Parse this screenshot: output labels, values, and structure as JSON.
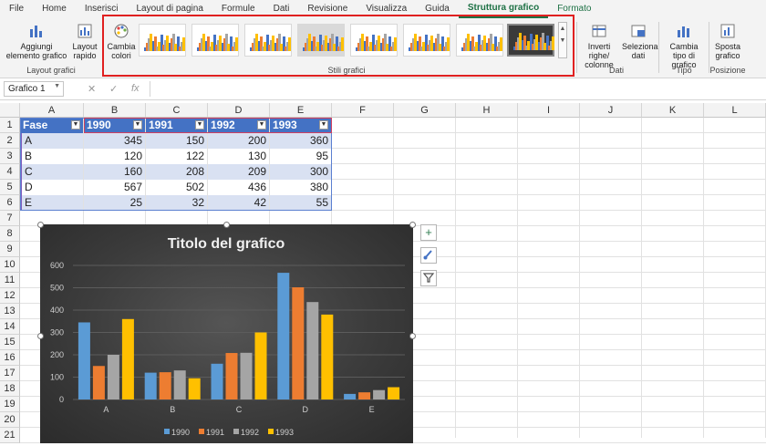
{
  "menu": {
    "tabs": [
      "File",
      "Home",
      "Inserisci",
      "Layout di pagina",
      "Formule",
      "Dati",
      "Revisione",
      "Visualizza",
      "Guida",
      "Struttura grafico",
      "Formato"
    ],
    "active": "Struttura grafico"
  },
  "ribbon": {
    "add_element": "Aggiungi elemento grafico",
    "quick_layout": "Layout rapido",
    "group_layout": "Layout grafici",
    "change_colors": "Cambia colori",
    "group_styles": "Stili grafici",
    "switch_row_col": "Inverti righe/ colonne",
    "select_data": "Seleziona dati",
    "group_data": "Dati",
    "change_type": "Cambia tipo di grafico",
    "group_type": "Tipo",
    "move_chart": "Sposta grafico",
    "group_position": "Posizione"
  },
  "formula_bar": {
    "name_box": "Grafico 1",
    "fx": "fx"
  },
  "sheet": {
    "columns": [
      "A",
      "B",
      "C",
      "D",
      "E",
      "F",
      "G",
      "H",
      "I",
      "J",
      "K",
      "L"
    ],
    "rows": [
      "1",
      "2",
      "3",
      "4",
      "5",
      "6",
      "7",
      "8",
      "9",
      "10",
      "11",
      "12",
      "13",
      "14",
      "15",
      "16",
      "17",
      "18",
      "19",
      "20",
      "21"
    ],
    "table": {
      "headers": [
        "Fase",
        "1990",
        "1991",
        "1992",
        "1993"
      ],
      "rows": [
        [
          "A",
          "345",
          "150",
          "200",
          "360"
        ],
        [
          "B",
          "120",
          "122",
          "130",
          "95"
        ],
        [
          "C",
          "160",
          "208",
          "209",
          "300"
        ],
        [
          "D",
          "567",
          "502",
          "436",
          "380"
        ],
        [
          "E",
          "25",
          "32",
          "42",
          "55"
        ]
      ]
    }
  },
  "chart_data": {
    "type": "bar",
    "title": "Titolo del grafico",
    "categories": [
      "A",
      "B",
      "C",
      "D",
      "E"
    ],
    "series": [
      {
        "name": "1990",
        "values": [
          345,
          120,
          160,
          567,
          25
        ],
        "color": "#5b9bd5"
      },
      {
        "name": "1991",
        "values": [
          150,
          122,
          208,
          502,
          32
        ],
        "color": "#ed7d31"
      },
      {
        "name": "1992",
        "values": [
          200,
          130,
          209,
          436,
          42
        ],
        "color": "#a5a5a5"
      },
      {
        "name": "1993",
        "values": [
          360,
          95,
          300,
          380,
          55
        ],
        "color": "#ffc000"
      }
    ],
    "y_ticks": [
      "0",
      "100",
      "200",
      "300",
      "400",
      "500",
      "600"
    ],
    "ylim": [
      0,
      600
    ],
    "grid": true,
    "legend": "bottom",
    "style": "dark"
  },
  "side_tools": {
    "plus_icon": "plus-icon",
    "brush_icon": "brush-icon",
    "filter_icon": "filter-icon"
  }
}
